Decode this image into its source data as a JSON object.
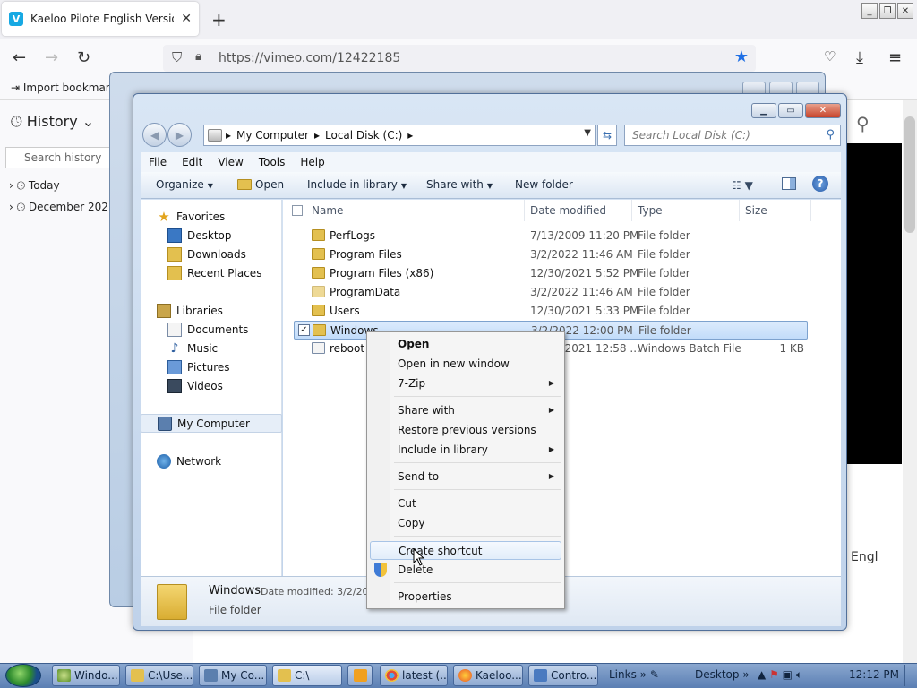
{
  "browser": {
    "tab_title": "Kaeloo Pilote English Version on",
    "tab_close": "✕",
    "new_tab": "+",
    "url": "https://vimeo.com/12422185",
    "bookmark_import": "Import bookmark",
    "sidebar_title": "History",
    "sidebar_search_placeholder": "Search history",
    "history_groups": [
      "Today",
      "December 202"
    ],
    "page_fragment": "Engl"
  },
  "explorer": {
    "breadcrumbs": [
      "My Computer",
      "Local Disk (C:)"
    ],
    "search_placeholder": "Search Local Disk (C:)",
    "menu": [
      "File",
      "Edit",
      "View",
      "Tools",
      "Help"
    ],
    "commands": {
      "organize": "Organize",
      "open": "Open",
      "include": "Include in library",
      "share": "Share with",
      "new_folder": "New folder"
    },
    "nav": {
      "favorites": "Favorites",
      "desktop": "Desktop",
      "downloads": "Downloads",
      "recent": "Recent Places",
      "libraries": "Libraries",
      "documents": "Documents",
      "music": "Music",
      "pictures": "Pictures",
      "videos": "Videos",
      "computer": "My Computer",
      "network": "Network"
    },
    "columns": {
      "name": "Name",
      "date": "Date modified",
      "type": "Type",
      "size": "Size"
    },
    "files": [
      {
        "name": "PerfLogs",
        "date": "7/13/2009 11:20 PM",
        "type": "File folder",
        "size": ""
      },
      {
        "name": "Program Files",
        "date": "3/2/2022 11:46 AM",
        "type": "File folder",
        "size": ""
      },
      {
        "name": "Program Files (x86)",
        "date": "12/30/2021 5:52 PM",
        "type": "File folder",
        "size": ""
      },
      {
        "name": "ProgramData",
        "date": "3/2/2022 11:46 AM",
        "type": "File folder",
        "size": ""
      },
      {
        "name": "Users",
        "date": "12/30/2021 5:33 PM",
        "type": "File folder",
        "size": ""
      },
      {
        "name": "Windows",
        "date": "3/2/2022 12:00 PM",
        "type": "File folder",
        "size": ""
      },
      {
        "name": "reboot",
        "date": "12/30/2021 12:58 ...",
        "type": "Windows Batch File",
        "size": "1 KB"
      }
    ],
    "details": {
      "name": "Windows",
      "modified": "Date modified: 3/2/20",
      "type": "File folder"
    }
  },
  "context_menu": {
    "open": "Open",
    "open_new_window": "Open in new window",
    "seven_zip": "7-Zip",
    "share_with": "Share with",
    "restore": "Restore previous versions",
    "include_library": "Include in library",
    "send_to": "Send to",
    "cut": "Cut",
    "copy": "Copy",
    "create_shortcut": "Create shortcut",
    "delete": "Delete",
    "properties": "Properties"
  },
  "taskbar": {
    "buttons": [
      "Windo...",
      "C:\\Use...",
      "My Co...",
      "C:\\",
      "latest (...",
      "Kaeloo...",
      "Contro..."
    ],
    "links": "Links",
    "desktop": "Desktop",
    "clock": "12:12 PM"
  },
  "colors": {
    "selection": "#c2dcfa",
    "accent": "#1f6fe5",
    "folder": "#e3c04f"
  }
}
